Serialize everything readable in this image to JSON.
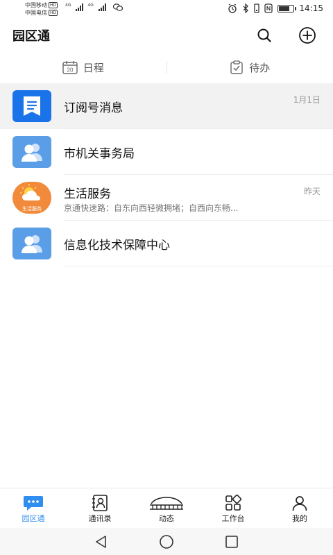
{
  "status_bar": {
    "carrier1": "中国移动",
    "carrier2": "中国电信",
    "hd": "HD",
    "net1": "4G",
    "net2": "4G",
    "time": "14:15",
    "battery_level": 0.8
  },
  "header": {
    "title": "园区通",
    "search_icon": "search-icon",
    "add_icon": "plus-circle-icon"
  },
  "tabs": [
    {
      "label": "日程",
      "icon": "calendar-icon",
      "icon_text": "20"
    },
    {
      "label": "待办",
      "icon": "todo-clipboard-icon"
    }
  ],
  "conversations": [
    {
      "title": "订阅号消息",
      "subtitle": "",
      "time": "1月1日",
      "avatar": "subscription-icon",
      "color": "#1a73e8"
    },
    {
      "title": "市机关事务局",
      "subtitle": "",
      "time": "",
      "avatar": "group-avatar-icon",
      "color": "#5b9ee8"
    },
    {
      "title": "生活服务",
      "subtitle": "京通快速路：自东向西轻微拥堵；自西向东畅...",
      "time": "昨天",
      "avatar": "life-service-icon",
      "avatar_text": "生活服务",
      "color": "#f28a3c"
    },
    {
      "title": "信息化技术保障中心",
      "subtitle": "",
      "time": "",
      "avatar": "group-avatar-icon",
      "color": "#5b9ee8"
    }
  ],
  "bottom_nav": [
    {
      "label": "园区通",
      "icon": "chat-bubble-icon",
      "active": true
    },
    {
      "label": "通讯录",
      "icon": "contacts-icon",
      "active": false
    },
    {
      "label": "动态",
      "icon": "stadium-icon",
      "active": false
    },
    {
      "label": "工作台",
      "icon": "workbench-grid-icon",
      "active": false
    },
    {
      "label": "我的",
      "icon": "user-icon",
      "active": false
    }
  ],
  "colors": {
    "accent": "#2f8ef0",
    "subscription": "#1a73e8",
    "group": "#5b9ee8",
    "life": "#f28a3c"
  }
}
